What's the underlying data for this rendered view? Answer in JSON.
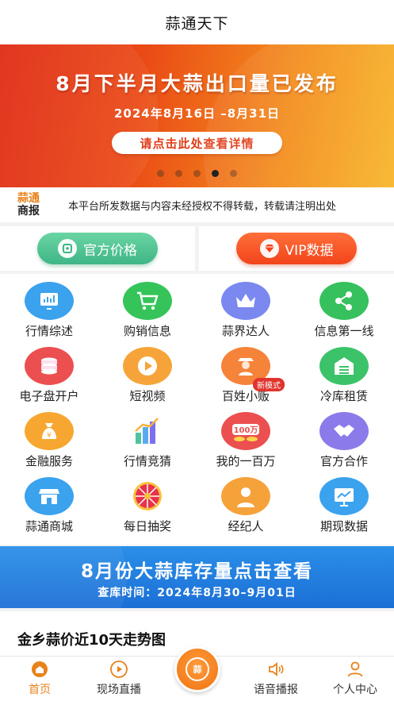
{
  "header": {
    "title": "蒜通天下"
  },
  "banner": {
    "title": "8月下半月大蒜出口量已发布",
    "date": "2024年8月16日 –8月31日",
    "cta": "请点击此处查看详情",
    "slides": 5,
    "active_slide": 4
  },
  "notice": {
    "logo_top": "蒜通",
    "logo_bottom": "商报",
    "text": "本平台所发数据与内容未经授权不得转载，转载请注明出处"
  },
  "quick": {
    "official_price": "官方价格",
    "vip_data": "VIP数据"
  },
  "grid": [
    {
      "label": "行情综述",
      "icon": "chart-screen-icon",
      "color": "#3ba2ee"
    },
    {
      "label": "购销信息",
      "icon": "shopping-cart-icon",
      "color": "#35c459"
    },
    {
      "label": "蒜界达人",
      "icon": "crown-icon",
      "color": "#7a88f0"
    },
    {
      "label": "信息第一线",
      "icon": "share-icon",
      "color": "#36c15e"
    },
    {
      "label": "电子盘开户",
      "icon": "coins-icon",
      "color": "#ec4f4f"
    },
    {
      "label": "短视频",
      "icon": "play-icon",
      "color": "#f6a43a"
    },
    {
      "label": "百姓小贩",
      "icon": "vendor-person-icon",
      "color": "#f5833a",
      "badge": "新模式"
    },
    {
      "label": "冷库租赁",
      "icon": "warehouse-icon",
      "color": "#3cc36a"
    },
    {
      "label": "金融服务",
      "icon": "money-bag-icon",
      "color": "#f7a731"
    },
    {
      "label": "行情竞猜",
      "icon": "bar-chart-3d-icon",
      "color": "#f3b13c"
    },
    {
      "label": "我的一百万",
      "icon": "million-coins-icon",
      "color": "#ec4f4f"
    },
    {
      "label": "官方合作",
      "icon": "handshake-icon",
      "color": "#8b7bea"
    },
    {
      "label": "蒜通商城",
      "icon": "store-icon",
      "color": "#3ba2ee"
    },
    {
      "label": "每日抽奖",
      "icon": "prize-wheel-icon",
      "color": "#e8334a"
    },
    {
      "label": "经纪人",
      "icon": "agent-person-icon",
      "color": "#f6a23a"
    },
    {
      "label": "期现数据",
      "icon": "trend-board-icon",
      "color": "#3ba2ee"
    }
  ],
  "ad": {
    "title": "8月份大蒜库存量点击查看",
    "subtitle": "查库时间：2024年8月30–9月01日"
  },
  "section": {
    "title": "金乡蒜价近10天走势图"
  },
  "tabbar": {
    "home": "首页",
    "live": "现场直播",
    "center": "蒜",
    "voice": "语音播报",
    "profile": "个人中心"
  },
  "colors": {
    "accent": "#e8821a",
    "banner_red": "#e02a14",
    "ad_blue": "#1c6fd6"
  }
}
